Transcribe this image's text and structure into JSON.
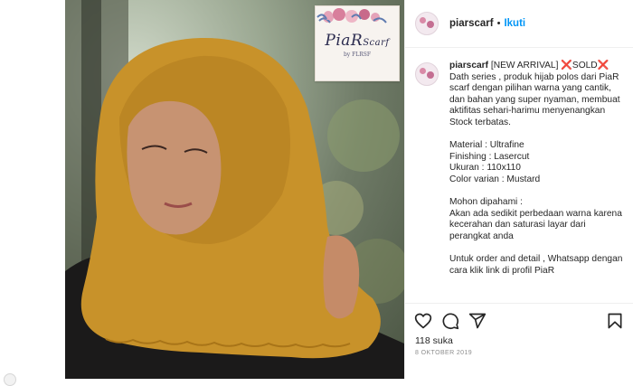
{
  "post": {
    "image_alt": "Woman wearing a mustard hijab scarf",
    "brand": {
      "name": "PiaR",
      "name_script": "Scarf",
      "sub": "by FLRSF"
    }
  },
  "header": {
    "username": "piarscarf",
    "separator": "•",
    "follow_label": "Ikuti"
  },
  "caption": {
    "username": "piarscarf",
    "text": " [NEW ARRIVAL] ❌SOLD❌\nDath series , produk hijab polos dari PiaR scarf dengan pilihan warna yang cantik, dan bahan yang super nyaman, membuat aktifitas sehari-harimu menyenangkan\nStock terbatas.\n\nMaterial : Ultrafine\nFinishing : Lasercut\nUkuran : 110x110\nColor varian : Mustard\n\nMohon dipahami :\nAkan ada sedikit perbedaan warna karena kecerahan dan saturasi layar dari perangkat anda\n\nUntuk order and detail , Whatsapp dengan cara klik link di profil PiaR"
  },
  "actions": {
    "icons": [
      "heart-icon",
      "comment-icon",
      "share-icon",
      "bookmark-icon"
    ],
    "likes": "118 suka",
    "date": "8 OKTOBER 2019"
  },
  "colors": {
    "follow": "#0095f6",
    "text": "#262626",
    "muted": "#8e8e8e",
    "hijab": "#c8922a"
  }
}
